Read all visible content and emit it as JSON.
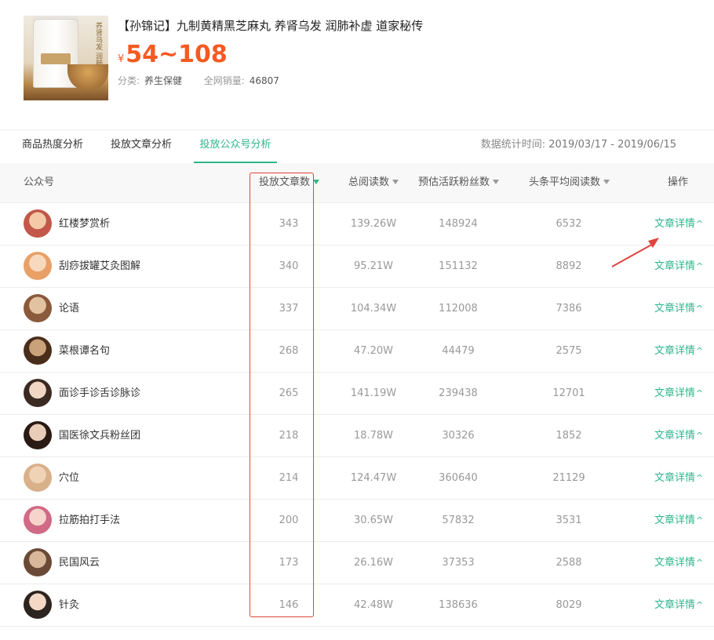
{
  "product": {
    "title": "【孙锦记】九制黄精黑芝麻丸 养肾乌发 润肺补虚 道家秘传",
    "currency": "¥",
    "price": "54~108",
    "category_label": "分类:",
    "category_value": "养生保健",
    "sales_label": "全网销量:",
    "sales_value": "46807",
    "image_text": "养肾乌发 润肺补虚"
  },
  "tabs": [
    {
      "label": "商品热度分析",
      "active": false
    },
    {
      "label": "投放文章分析",
      "active": false
    },
    {
      "label": "投放公众号分析",
      "active": true
    }
  ],
  "stat_time": {
    "label": "数据统计时间:",
    "value": "2019/03/17 - 2019/06/15"
  },
  "table": {
    "headers": [
      "公众号",
      "投放文章数",
      "总阅读数",
      "预估活跃粉丝数",
      "头条平均阅读数",
      "操作"
    ],
    "action_label": "文章详情",
    "rows": [
      {
        "name": "红楼梦赏析",
        "articles": "343",
        "reads": "139.26W",
        "fans": "148924",
        "avg": "6532"
      },
      {
        "name": "刮痧拔罐艾灸图解",
        "articles": "340",
        "reads": "95.21W",
        "fans": "151132",
        "avg": "8892"
      },
      {
        "name": "论语",
        "articles": "337",
        "reads": "104.34W",
        "fans": "112008",
        "avg": "7386"
      },
      {
        "name": "菜根谭名句",
        "articles": "268",
        "reads": "47.20W",
        "fans": "44479",
        "avg": "2575"
      },
      {
        "name": "面诊手诊舌诊脉诊",
        "articles": "265",
        "reads": "141.19W",
        "fans": "239438",
        "avg": "12701"
      },
      {
        "name": "国医徐文兵粉丝团",
        "articles": "218",
        "reads": "18.78W",
        "fans": "30326",
        "avg": "1852"
      },
      {
        "name": "穴位",
        "articles": "214",
        "reads": "124.47W",
        "fans": "360640",
        "avg": "21129"
      },
      {
        "name": "拉筋拍打手法",
        "articles": "200",
        "reads": "30.65W",
        "fans": "57832",
        "avg": "3531"
      },
      {
        "name": "民国风云",
        "articles": "173",
        "reads": "26.16W",
        "fans": "37353",
        "avg": "2588"
      },
      {
        "name": "针灸",
        "articles": "146",
        "reads": "42.48W",
        "fans": "138636",
        "avg": "8029"
      }
    ]
  },
  "colors": {
    "accent": "#2fb68c",
    "price": "#f55a22",
    "annotation": "#e0443a"
  }
}
